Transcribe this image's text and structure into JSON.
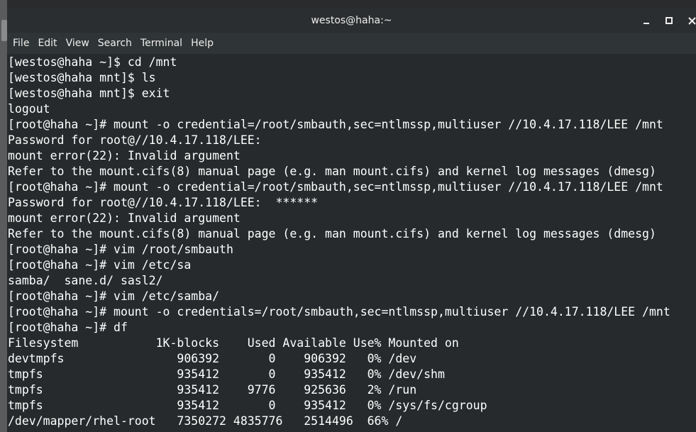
{
  "window": {
    "title": "westos@haha:~"
  },
  "menubar": {
    "items": [
      "File",
      "Edit",
      "View",
      "Search",
      "Terminal",
      "Help"
    ]
  },
  "icons": {
    "minimize": "minimize-icon",
    "maximize": "maximize-icon",
    "close": "close-icon"
  },
  "terminal": {
    "lines": [
      "[westos@haha ~]$ cd /mnt",
      "[westos@haha mnt]$ ls",
      "[westos@haha mnt]$ exit",
      "logout",
      "[root@haha ~]# mount -o credential=/root/smbauth,sec=ntlmssp,multiuser //10.4.17.118/LEE /mnt",
      "Password for root@//10.4.17.118/LEE:",
      "mount error(22): Invalid argument",
      "Refer to the mount.cifs(8) manual page (e.g. man mount.cifs) and kernel log messages (dmesg)",
      "[root@haha ~]# mount -o credential=/root/smbauth,sec=ntlmssp,multiuser //10.4.17.118/LEE /mnt",
      "Password for root@//10.4.17.118/LEE:  ******",
      "mount error(22): Invalid argument",
      "Refer to the mount.cifs(8) manual page (e.g. man mount.cifs) and kernel log messages (dmesg)",
      "[root@haha ~]# vim /root/smbauth",
      "[root@haha ~]# vim /etc/sa",
      "samba/  sane.d/ sasl2/",
      "[root@haha ~]# vim /etc/samba/",
      "[root@haha ~]# mount -o credentials=/root/smbauth,sec=ntlmssp,multiuser //10.4.17.118/LEE /mnt",
      "[root@haha ~]# df",
      "Filesystem           1K-blocks    Used Available Use% Mounted on",
      "devtmpfs                906392       0    906392   0% /dev",
      "tmpfs                   935412       0    935412   0% /dev/shm",
      "tmpfs                   935412    9776    925636   2% /run",
      "tmpfs                   935412       0    935412   0% /sys/fs/cgroup",
      "/dev/mapper/rhel-root   7350272 4835776   2514496  66% /"
    ]
  }
}
